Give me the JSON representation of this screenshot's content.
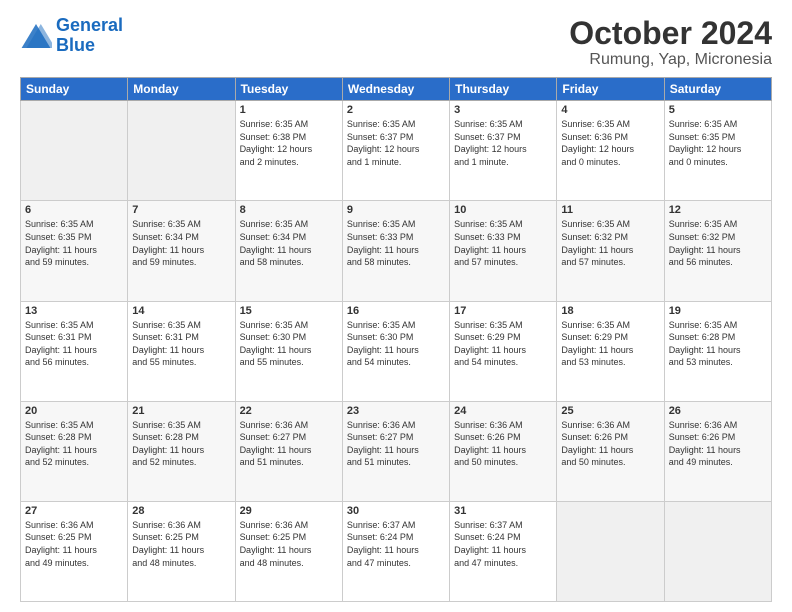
{
  "logo": {
    "text_general": "General",
    "text_blue": "Blue"
  },
  "header": {
    "month": "October 2024",
    "location": "Rumung, Yap, Micronesia"
  },
  "days_of_week": [
    "Sunday",
    "Monday",
    "Tuesday",
    "Wednesday",
    "Thursday",
    "Friday",
    "Saturday"
  ],
  "weeks": [
    [
      {
        "num": "",
        "info": ""
      },
      {
        "num": "",
        "info": ""
      },
      {
        "num": "1",
        "info": "Sunrise: 6:35 AM\nSunset: 6:38 PM\nDaylight: 12 hours\nand 2 minutes."
      },
      {
        "num": "2",
        "info": "Sunrise: 6:35 AM\nSunset: 6:37 PM\nDaylight: 12 hours\nand 1 minute."
      },
      {
        "num": "3",
        "info": "Sunrise: 6:35 AM\nSunset: 6:37 PM\nDaylight: 12 hours\nand 1 minute."
      },
      {
        "num": "4",
        "info": "Sunrise: 6:35 AM\nSunset: 6:36 PM\nDaylight: 12 hours\nand 0 minutes."
      },
      {
        "num": "5",
        "info": "Sunrise: 6:35 AM\nSunset: 6:35 PM\nDaylight: 12 hours\nand 0 minutes."
      }
    ],
    [
      {
        "num": "6",
        "info": "Sunrise: 6:35 AM\nSunset: 6:35 PM\nDaylight: 11 hours\nand 59 minutes."
      },
      {
        "num": "7",
        "info": "Sunrise: 6:35 AM\nSunset: 6:34 PM\nDaylight: 11 hours\nand 59 minutes."
      },
      {
        "num": "8",
        "info": "Sunrise: 6:35 AM\nSunset: 6:34 PM\nDaylight: 11 hours\nand 58 minutes."
      },
      {
        "num": "9",
        "info": "Sunrise: 6:35 AM\nSunset: 6:33 PM\nDaylight: 11 hours\nand 58 minutes."
      },
      {
        "num": "10",
        "info": "Sunrise: 6:35 AM\nSunset: 6:33 PM\nDaylight: 11 hours\nand 57 minutes."
      },
      {
        "num": "11",
        "info": "Sunrise: 6:35 AM\nSunset: 6:32 PM\nDaylight: 11 hours\nand 57 minutes."
      },
      {
        "num": "12",
        "info": "Sunrise: 6:35 AM\nSunset: 6:32 PM\nDaylight: 11 hours\nand 56 minutes."
      }
    ],
    [
      {
        "num": "13",
        "info": "Sunrise: 6:35 AM\nSunset: 6:31 PM\nDaylight: 11 hours\nand 56 minutes."
      },
      {
        "num": "14",
        "info": "Sunrise: 6:35 AM\nSunset: 6:31 PM\nDaylight: 11 hours\nand 55 minutes."
      },
      {
        "num": "15",
        "info": "Sunrise: 6:35 AM\nSunset: 6:30 PM\nDaylight: 11 hours\nand 55 minutes."
      },
      {
        "num": "16",
        "info": "Sunrise: 6:35 AM\nSunset: 6:30 PM\nDaylight: 11 hours\nand 54 minutes."
      },
      {
        "num": "17",
        "info": "Sunrise: 6:35 AM\nSunset: 6:29 PM\nDaylight: 11 hours\nand 54 minutes."
      },
      {
        "num": "18",
        "info": "Sunrise: 6:35 AM\nSunset: 6:29 PM\nDaylight: 11 hours\nand 53 minutes."
      },
      {
        "num": "19",
        "info": "Sunrise: 6:35 AM\nSunset: 6:28 PM\nDaylight: 11 hours\nand 53 minutes."
      }
    ],
    [
      {
        "num": "20",
        "info": "Sunrise: 6:35 AM\nSunset: 6:28 PM\nDaylight: 11 hours\nand 52 minutes."
      },
      {
        "num": "21",
        "info": "Sunrise: 6:35 AM\nSunset: 6:28 PM\nDaylight: 11 hours\nand 52 minutes."
      },
      {
        "num": "22",
        "info": "Sunrise: 6:36 AM\nSunset: 6:27 PM\nDaylight: 11 hours\nand 51 minutes."
      },
      {
        "num": "23",
        "info": "Sunrise: 6:36 AM\nSunset: 6:27 PM\nDaylight: 11 hours\nand 51 minutes."
      },
      {
        "num": "24",
        "info": "Sunrise: 6:36 AM\nSunset: 6:26 PM\nDaylight: 11 hours\nand 50 minutes."
      },
      {
        "num": "25",
        "info": "Sunrise: 6:36 AM\nSunset: 6:26 PM\nDaylight: 11 hours\nand 50 minutes."
      },
      {
        "num": "26",
        "info": "Sunrise: 6:36 AM\nSunset: 6:26 PM\nDaylight: 11 hours\nand 49 minutes."
      }
    ],
    [
      {
        "num": "27",
        "info": "Sunrise: 6:36 AM\nSunset: 6:25 PM\nDaylight: 11 hours\nand 49 minutes."
      },
      {
        "num": "28",
        "info": "Sunrise: 6:36 AM\nSunset: 6:25 PM\nDaylight: 11 hours\nand 48 minutes."
      },
      {
        "num": "29",
        "info": "Sunrise: 6:36 AM\nSunset: 6:25 PM\nDaylight: 11 hours\nand 48 minutes."
      },
      {
        "num": "30",
        "info": "Sunrise: 6:37 AM\nSunset: 6:24 PM\nDaylight: 11 hours\nand 47 minutes."
      },
      {
        "num": "31",
        "info": "Sunrise: 6:37 AM\nSunset: 6:24 PM\nDaylight: 11 hours\nand 47 minutes."
      },
      {
        "num": "",
        "info": ""
      },
      {
        "num": "",
        "info": ""
      }
    ]
  ]
}
